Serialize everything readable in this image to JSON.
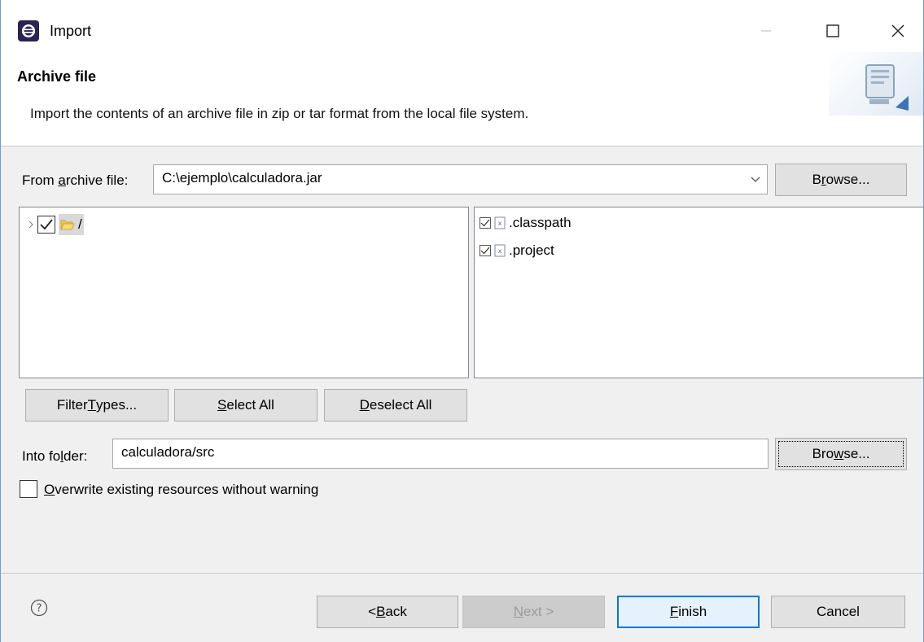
{
  "window": {
    "title": "Import"
  },
  "header": {
    "title": "Archive file",
    "description": "Import the contents of an archive file in zip or tar format from the local file system."
  },
  "archive": {
    "label_pre": "From ",
    "label_u": "a",
    "label_post": "rchive file:",
    "value": "C:\\ejemplo\\calculadora.jar",
    "browse_pre": "B",
    "browse_u": "r",
    "browse_post": "owse..."
  },
  "left_tree": {
    "items": [
      {
        "label": "/",
        "checked": true
      }
    ]
  },
  "right_list": {
    "items": [
      {
        "label": ".classpath",
        "checked": true
      },
      {
        "label": ".project",
        "checked": true
      }
    ]
  },
  "buttons": {
    "filter_pre": "Filter ",
    "filter_u": "T",
    "filter_post": "ypes...",
    "select_all_u": "S",
    "select_all_post": "elect All",
    "deselect_all_u": "D",
    "deselect_all_post": "eselect All"
  },
  "into_folder": {
    "label_pre": "Into fo",
    "label_u": "l",
    "label_post": "der:",
    "value": "calculadora/src",
    "browse_pre": "Bro",
    "browse_u": "w",
    "browse_post": "se..."
  },
  "overwrite": {
    "label_u": "O",
    "label_post": "verwrite existing resources without warning",
    "checked": false
  },
  "footer": {
    "back_pre": "< ",
    "back_u": "B",
    "back_post": "ack",
    "next_u": "N",
    "next_post": "ext >",
    "finish_u": "F",
    "finish_post": "inish",
    "cancel": "Cancel"
  }
}
